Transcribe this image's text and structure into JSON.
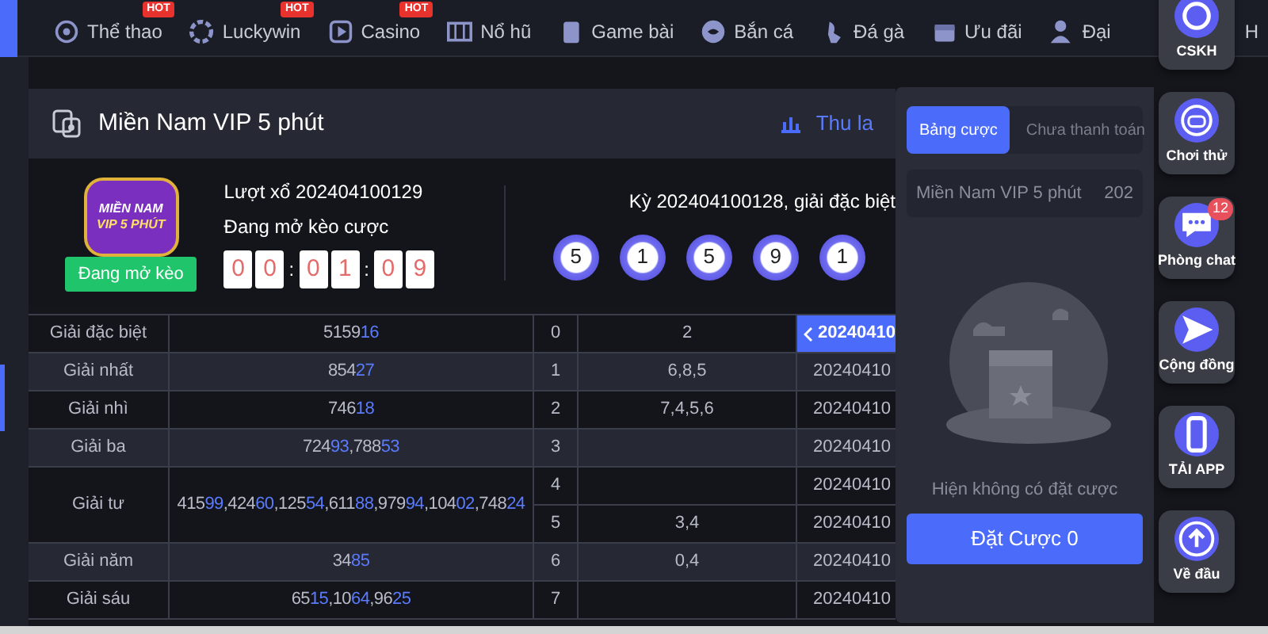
{
  "nav": [
    {
      "label": "Thể thao",
      "badge": "HOT"
    },
    {
      "label": "Luckywin",
      "badge": "HOT"
    },
    {
      "label": "Casino",
      "badge": "HOT"
    },
    {
      "label": "Nổ hũ"
    },
    {
      "label": "Game bài"
    },
    {
      "label": "Bắn cá"
    },
    {
      "label": "Đá gà"
    },
    {
      "label": "Ưu đãi"
    },
    {
      "label": "Đại"
    },
    {
      "label": "H"
    }
  ],
  "game": {
    "title": "Miền Nam VIP 5 phút",
    "link": "Thu la",
    "logo": {
      "line1": "MIỀN NAM",
      "line2": "VIP 5 PHÚT",
      "status": "Đang mở kèo"
    },
    "round": "Lượt xổ 202404100129",
    "round_status": "Đang mở kèo cược",
    "countdown": [
      [
        "0",
        "0"
      ],
      [
        "0",
        "1"
      ],
      [
        "0",
        "9"
      ]
    ],
    "separator": ":",
    "last_draw": "Kỳ 202404100128, giải đặc biệt",
    "balls": [
      "5",
      "1",
      "5",
      "9",
      "1"
    ]
  },
  "prizes": [
    {
      "name": "Giải đặc biệt",
      "numbers": [
        {
          "lead": "5159",
          "tail": "16"
        }
      ]
    },
    {
      "name": "Giải nhất",
      "numbers": [
        {
          "lead": "854",
          "tail": "27"
        }
      ]
    },
    {
      "name": "Giải nhì",
      "numbers": [
        {
          "lead": "746",
          "tail": "18"
        }
      ]
    },
    {
      "name": "Giải ba",
      "numbers": [
        {
          "lead": "724",
          "tail": "93"
        },
        {
          "lead": ",788",
          "tail": "53"
        }
      ]
    },
    {
      "name": "Giải tư",
      "numbers": [
        {
          "lead": "415",
          "tail": "99"
        },
        {
          "lead": ",424",
          "tail": "60"
        },
        {
          "lead": ",125",
          "tail": "54"
        },
        {
          "lead": ",611",
          "tail": "88"
        },
        {
          "lead": ",979",
          "tail": "94"
        },
        {
          "lead": ",104",
          "tail": "02"
        },
        {
          "lead": ",748",
          "tail": "24"
        }
      ]
    },
    {
      "name": "Giải năm",
      "numbers": [
        {
          "lead": "34",
          "tail": "85"
        }
      ]
    },
    {
      "name": "Giải sáu",
      "numbers": [
        {
          "lead": "65",
          "tail": "15"
        },
        {
          "lead": ",10",
          "tail": "64"
        },
        {
          "lead": ",96",
          "tail": "25"
        }
      ]
    }
  ],
  "heads": [
    {
      "digit": "0",
      "tails": "2",
      "period": "20240410",
      "selected": true
    },
    {
      "digit": "1",
      "tails": "6,8,5",
      "period": "20240410",
      "selected": false
    },
    {
      "digit": "2",
      "tails": "7,4,5,6",
      "period": "20240410",
      "selected": false
    },
    {
      "digit": "3",
      "period": "20240410",
      "selected": false
    },
    {
      "digit": "4",
      "period": "20240410",
      "selected": false
    },
    {
      "digit": "5",
      "tails": "3,4",
      "period": "20240410",
      "selected": false
    },
    {
      "digit": "6",
      "tails": "0,4",
      "period": "20240410",
      "selected": false
    },
    {
      "digit": "7",
      "period": "20240410",
      "selected": false
    }
  ],
  "bet_panel": {
    "tabs": [
      {
        "label": "Bảng cược",
        "selected": true
      },
      {
        "label": "Chưa thanh toán",
        "selected": false
      }
    ],
    "game_name": "Miền Nam VIP 5 phút",
    "period": "202",
    "empty": "Hiện không có đặt cược",
    "button": "Đặt Cược 0"
  },
  "side_buttons": [
    {
      "kind": "support",
      "label": "CSKH"
    },
    {
      "kind": "game",
      "label": "Chơi thử"
    },
    {
      "kind": "chat",
      "label": "Phòng chat",
      "badge": "12"
    },
    {
      "kind": "send",
      "label": "Cộng đồng"
    },
    {
      "kind": "phone",
      "label": "TẢI APP"
    },
    {
      "kind": "up",
      "label": "Về đầu"
    }
  ]
}
